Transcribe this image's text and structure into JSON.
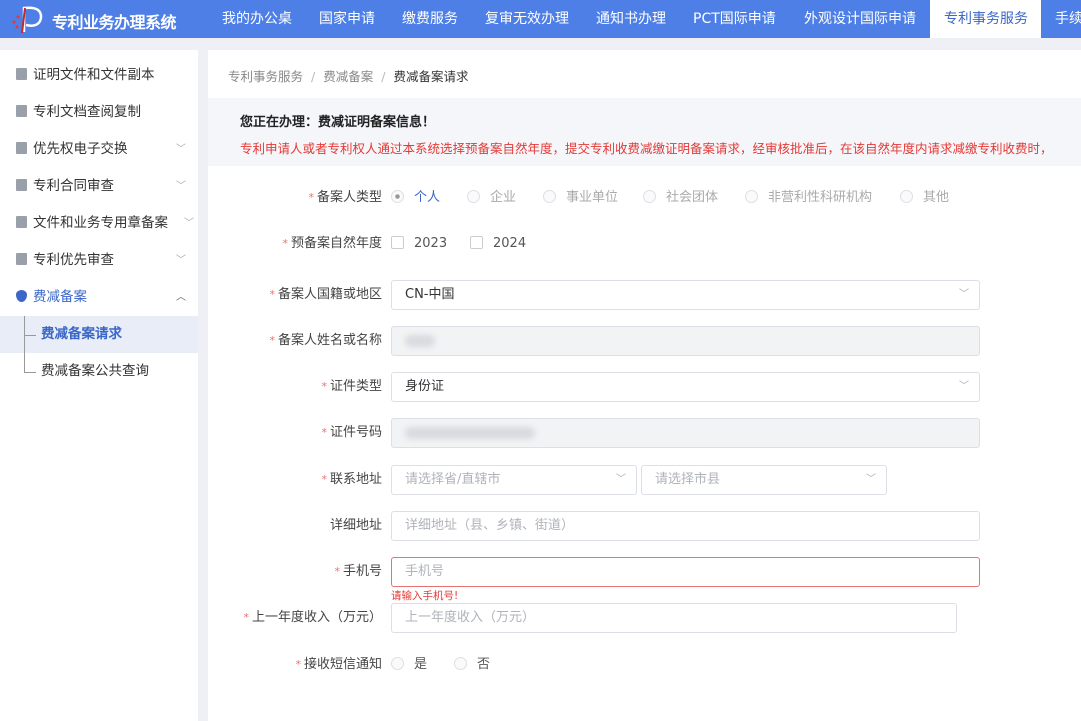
{
  "header": {
    "title": "专利业务办理系统",
    "nav": [
      "我的办公桌",
      "国家申请",
      "缴费服务",
      "复审无效办理",
      "通知书办理",
      "PCT国际申请",
      "外观设计国际申请",
      "专利事务服务",
      "手续"
    ],
    "active": "专利事务服务",
    "accent": "#4d7fe6"
  },
  "sidebar": {
    "items": [
      {
        "label": "证明文件和文件副本",
        "icon": "document-icon"
      },
      {
        "label": "专利文档查阅复制",
        "icon": "file-icon"
      },
      {
        "label": "优先权电子交换",
        "icon": "exchange-icon",
        "expandable": true
      },
      {
        "label": "专利合同审查",
        "icon": "contract-icon",
        "expandable": true
      },
      {
        "label": "文件和业务专用章备案",
        "icon": "seal-icon",
        "expandable": true
      },
      {
        "label": "专利优先审查",
        "icon": "priority-icon",
        "expandable": true
      },
      {
        "label": "费减备案",
        "icon": "shield-icon",
        "expanded": true
      }
    ],
    "subitems": [
      {
        "label": "费减备案请求",
        "active": true
      },
      {
        "label": "费减备案公共查询"
      }
    ]
  },
  "breadcrumb": [
    "专利事务服务",
    "费减备案",
    "费减备案请求"
  ],
  "notice": {
    "title": "您正在办理：费减证明备案信息！",
    "text": "专利申请人或者专利权人通过本系统选择预备案自然年度，提交专利收费减缴证明备案请求，经审核批准后，在该自然年度内请求减缴专利收费时，"
  },
  "form": {
    "filer_type": {
      "label": "备案人类型",
      "options": [
        "个人",
        "企业",
        "事业单位",
        "社会团体",
        "非营利性科研机构",
        "其他"
      ],
      "selected": "个人"
    },
    "year": {
      "label": "预备案自然年度",
      "options": [
        "2023",
        "2024"
      ]
    },
    "region": {
      "label": "备案人国籍或地区",
      "value": "CN-中国"
    },
    "name": {
      "label": "备案人姓名或名称"
    },
    "id_type": {
      "label": "证件类型",
      "value": "身份证"
    },
    "id_number": {
      "label": "证件号码"
    },
    "address": {
      "label": "联系地址",
      "province_placeholder": "请选择省/直辖市",
      "city_placeholder": "请选择市县"
    },
    "detail_address": {
      "label": "详细地址",
      "placeholder": "详细地址（县、乡镇、街道）"
    },
    "phone": {
      "label": "手机号",
      "placeholder": "手机号",
      "error": "请输入手机号!"
    },
    "income": {
      "label": "上一年度收入（万元）",
      "placeholder": "上一年度收入（万元）"
    },
    "sms": {
      "label": "接收短信通知",
      "options": [
        "是",
        "否"
      ]
    }
  }
}
